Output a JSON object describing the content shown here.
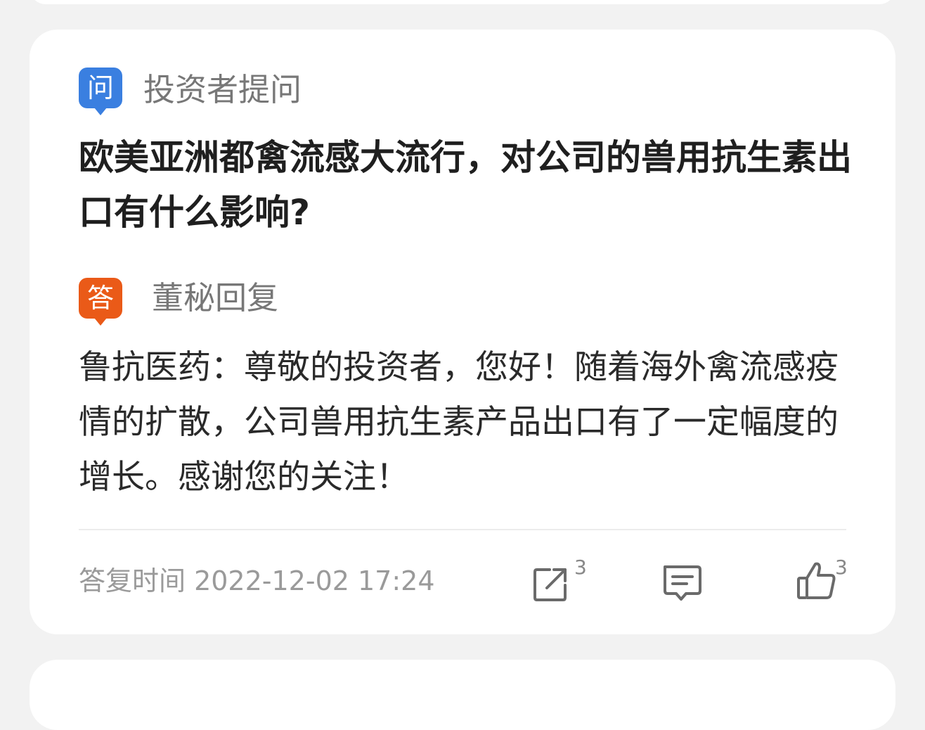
{
  "question": {
    "badge": "问",
    "label": "投资者提问",
    "text": "欧美亚洲都禽流感大流行，对公司的兽用抗生素出口有什么影响?"
  },
  "answer": {
    "badge": "答",
    "label": "董秘回复",
    "text": "鲁抗医药：尊敬的投资者，您好！随着海外禽流感疫情的扩散，公司兽用抗生素产品出口有了一定幅度的增长。感谢您的关注！"
  },
  "footer": {
    "time_label": "答复时间 2022-12-02 17:24",
    "share_icon": "share-icon",
    "share_count": "3",
    "comment_icon": "comment-icon",
    "like_icon": "thumbs-up-icon",
    "like_count": "3"
  },
  "colors": {
    "question_badge": "#3a7fe0",
    "answer_badge": "#ea5a18",
    "background": "#f2f2f2",
    "card": "#ffffff"
  }
}
